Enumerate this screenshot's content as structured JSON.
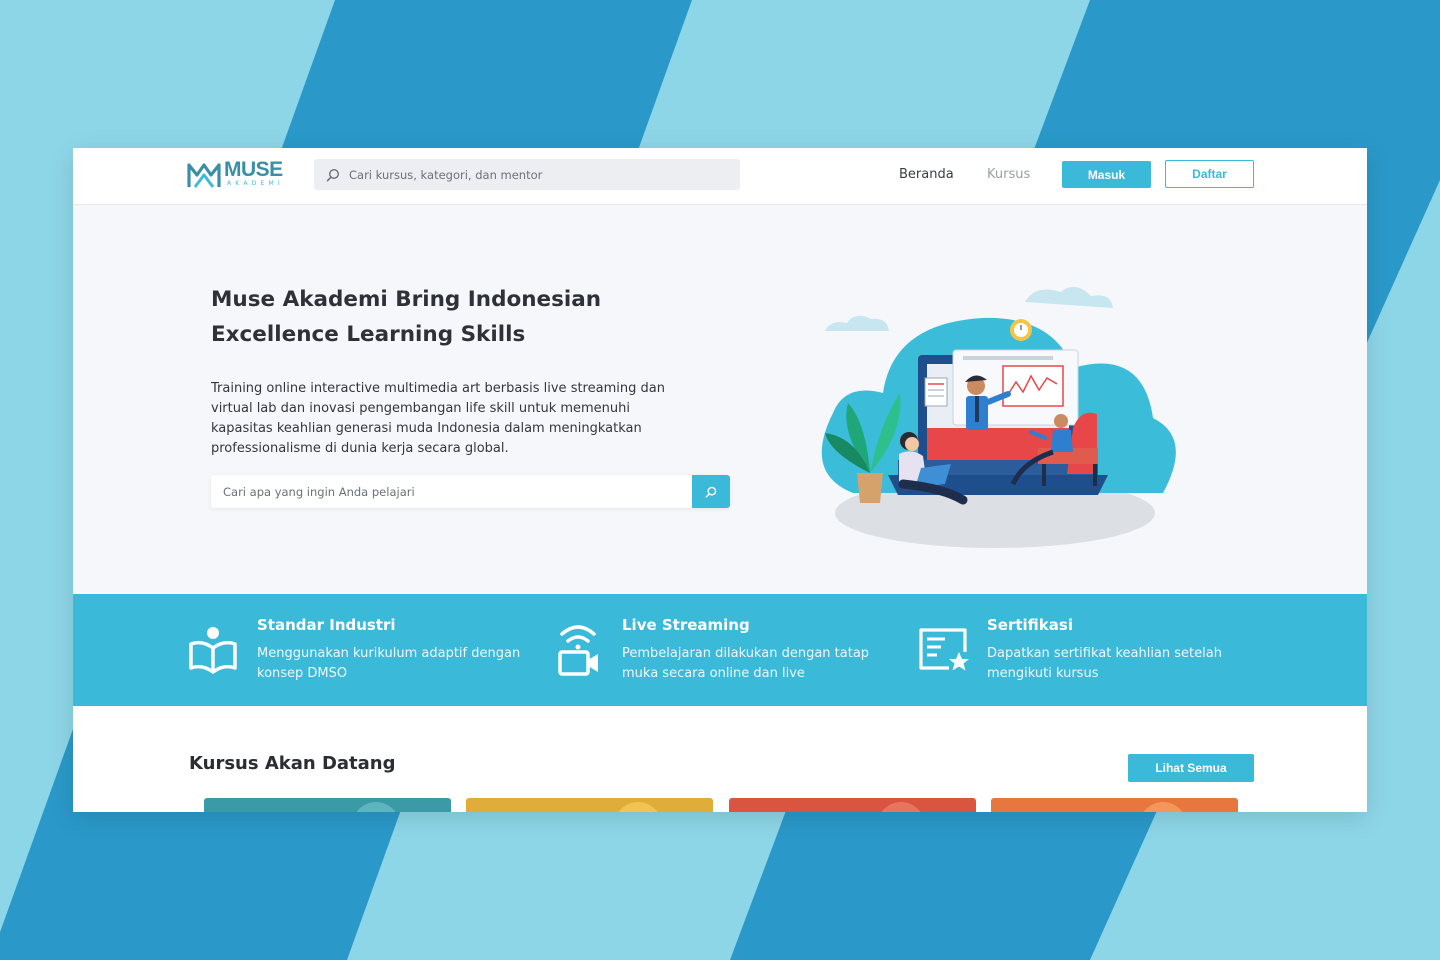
{
  "nav": {
    "logo_text": "MUSE",
    "logo_sub": "AKADEMI",
    "search_placeholder": "Cari kursus, kategori, dan mentor",
    "links": [
      "Beranda",
      "Kursus"
    ],
    "login_label": "Masuk",
    "register_label": "Daftar"
  },
  "hero": {
    "title_line1": "Muse Akademi Bring Indonesian",
    "title_line2": "Excellence Learning Skills",
    "description": "Training online interactive multimedia art berbasis live streaming dan virtual lab dan inovasi pengembangan life skill untuk memenuhi kapasitas keahlian generasi muda Indonesia dalam meningkatkan professionalisme di dunia kerja secara global.",
    "search_placeholder": "Cari apa yang ingin Anda pelajari"
  },
  "features": [
    {
      "title": "Standar Industri",
      "desc": "Menggunakan kurikulum adaptif dengan konsep DMSO",
      "icon": "open-book-reader-icon"
    },
    {
      "title": "Live Streaming",
      "desc": "Pembelajaran dilakukan dengan tatap muka secara online dan live",
      "icon": "video-camera-wifi-icon"
    },
    {
      "title": "Sertifikasi",
      "desc": "Dapatkan sertifikat keahlian setelah mengikuti kursus",
      "icon": "certificate-star-icon"
    }
  ],
  "courses": {
    "title": "Kursus Akan Datang",
    "view_all_label": "Lihat Semua",
    "card_colors": [
      "#3a9aa6",
      "#e0ad3b",
      "#d9553f",
      "#e8763f"
    ]
  },
  "colors": {
    "accent": "#3bb9d8",
    "background_light": "#8dd6e8",
    "background_dark": "#2a99c9"
  }
}
